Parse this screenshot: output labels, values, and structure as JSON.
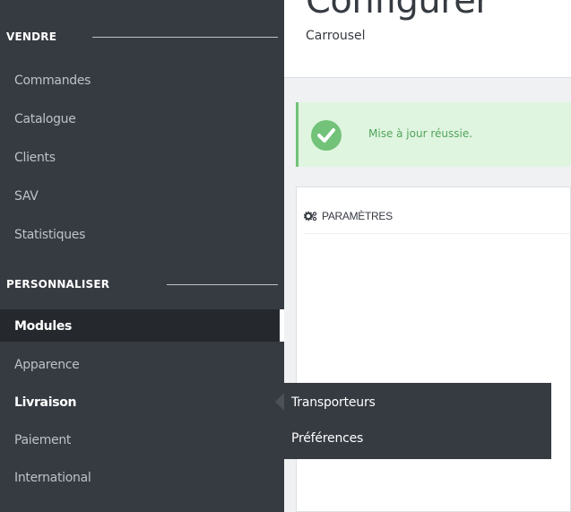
{
  "sidebar": {
    "sections": [
      {
        "label": "VENDRE"
      },
      {
        "label": "PERSONNALISER"
      }
    ],
    "items": [
      {
        "label": "Commandes"
      },
      {
        "label": "Catalogue"
      },
      {
        "label": "Clients"
      },
      {
        "label": "SAV"
      },
      {
        "label": "Statistiques"
      },
      {
        "label": "Modules"
      },
      {
        "label": "Apparence"
      },
      {
        "label": "Livraison"
      },
      {
        "label": "Paiement"
      },
      {
        "label": "International"
      }
    ]
  },
  "flyout": {
    "items": [
      {
        "label": "Transporteurs"
      },
      {
        "label": "Préférences"
      }
    ]
  },
  "header": {
    "title": "Configurer",
    "breadcrumb": "Carrousel"
  },
  "alert": {
    "text": "Mise à jour réussie.",
    "icon": "check-circle-icon",
    "color": "#72c279"
  },
  "panel": {
    "title": "PARAMÈTRES",
    "icon": "cogs-icon"
  },
  "colors": {
    "sidebar_bg": "#363a41",
    "active_bg": "#25282d",
    "success": "#72c279"
  }
}
